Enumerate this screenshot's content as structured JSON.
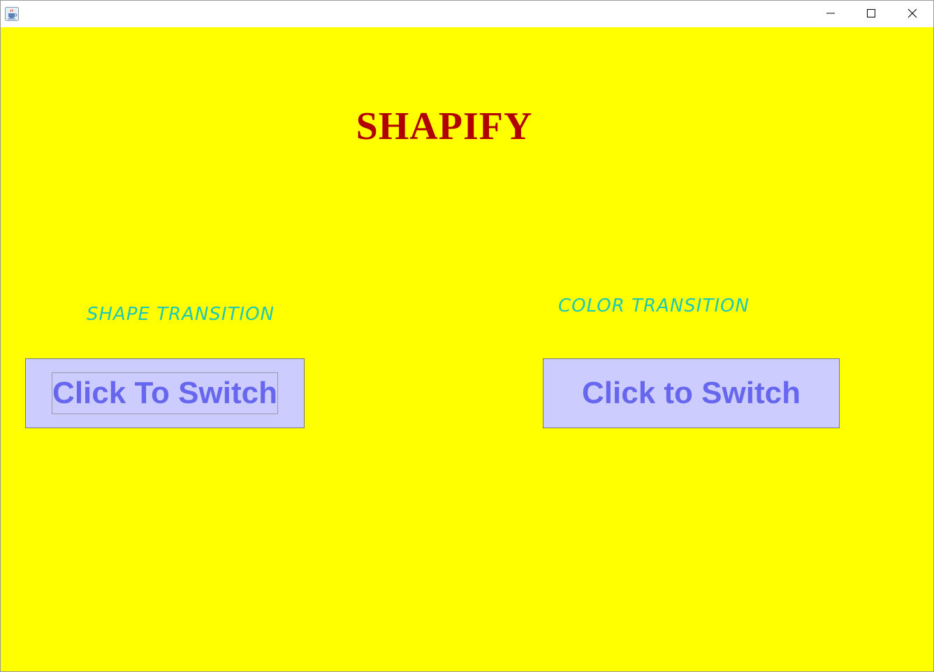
{
  "colors": {
    "background": "#ffff00",
    "title": "#b00000",
    "label": "#1ec8b4",
    "button_bg": "#ccccff",
    "button_text": "#6666ee"
  },
  "titlebar": {
    "app_icon": "java-coffee-cup-icon",
    "minimize_icon": "minimize-icon",
    "maximize_icon": "maximize-icon",
    "close_icon": "close-icon"
  },
  "main": {
    "title": "SHAPIFY",
    "shape_section": {
      "label": "SHAPE TRANSITION",
      "button_label": "Click To Switch"
    },
    "color_section": {
      "label": "COLOR TRANSITION",
      "button_label": "Click to Switch"
    }
  }
}
